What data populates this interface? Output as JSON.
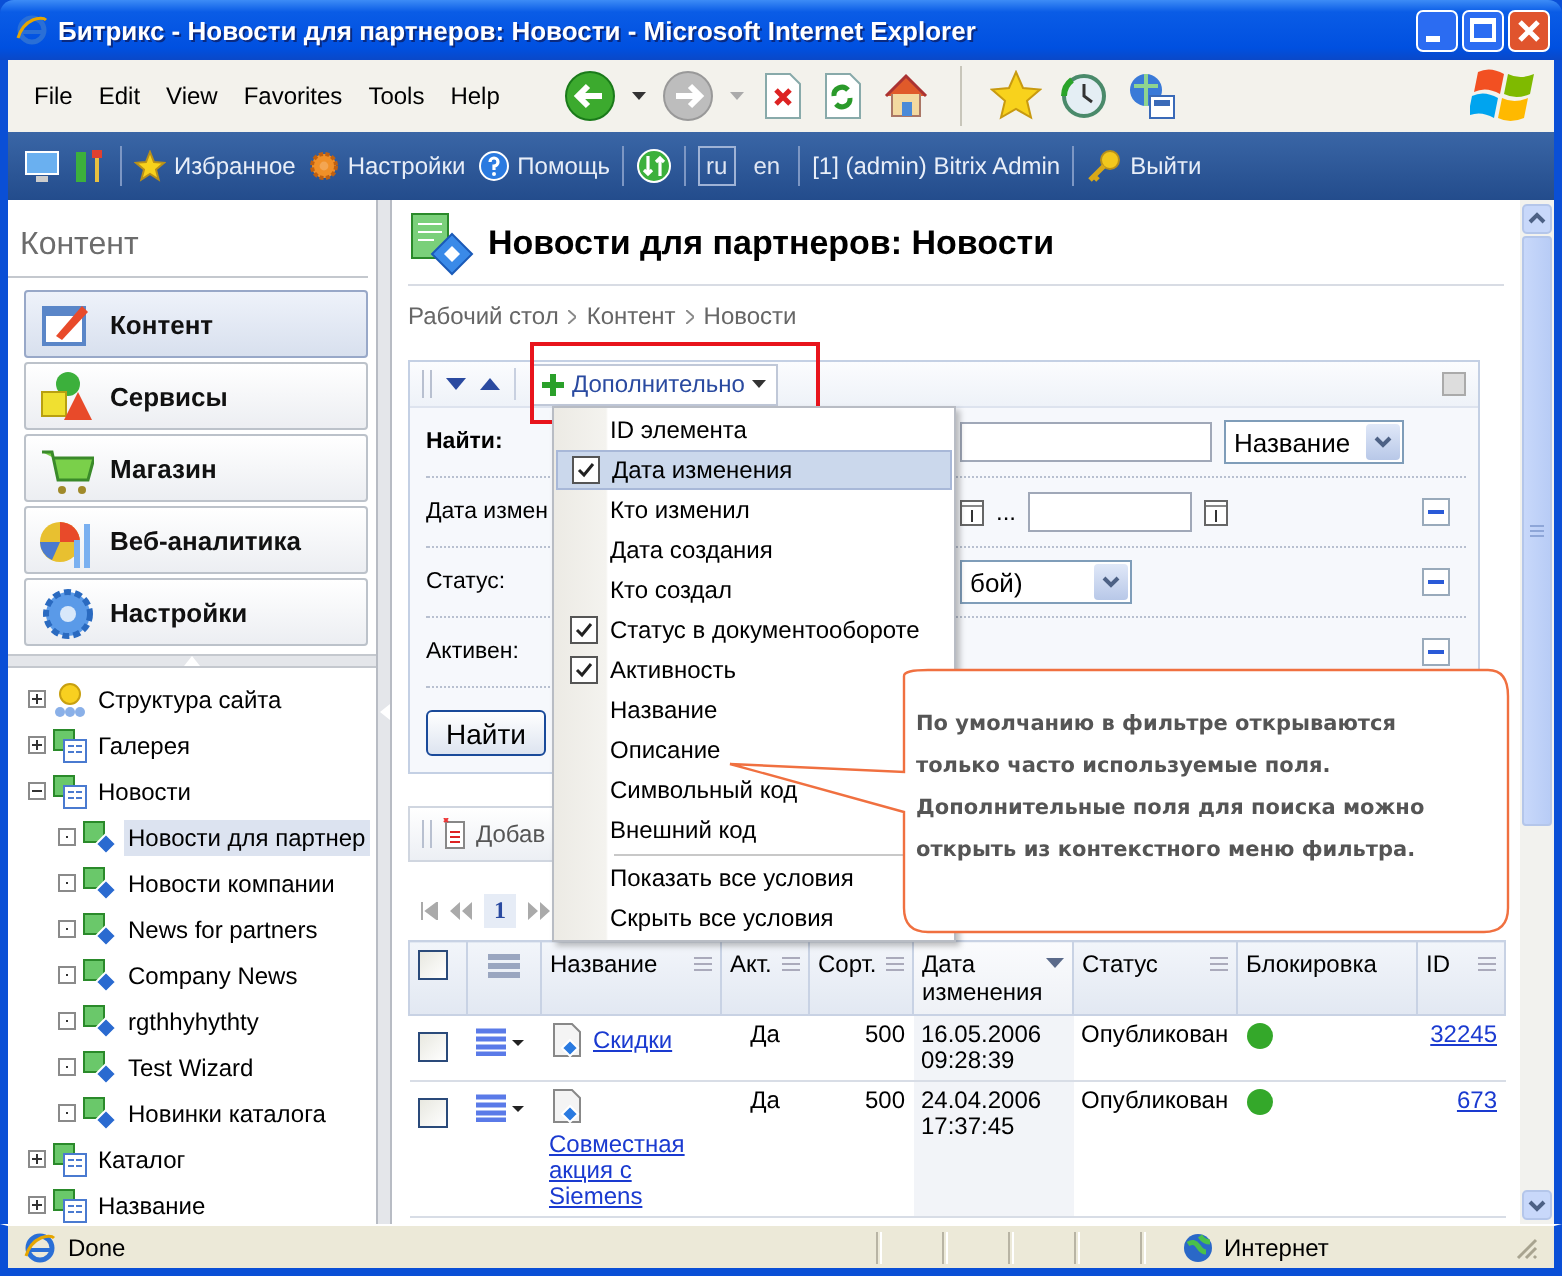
{
  "window": {
    "title": "Битрикс - Новости для партнеров: Новости - Microsoft Internet Explorer"
  },
  "menu_bar": [
    "File",
    "Edit",
    "View",
    "Favorites",
    "Tools",
    "Help"
  ],
  "admin_bar": {
    "links": [
      {
        "kind": "favorites",
        "label": "Избранное"
      },
      {
        "kind": "settings",
        "label": "Настройки"
      },
      {
        "kind": "help",
        "label": "Помощь"
      }
    ],
    "languages": [
      {
        "label": "ru",
        "selected": true
      },
      {
        "label": "en",
        "selected": false
      }
    ],
    "user": "[1] (admin) Bitrix Admin",
    "logout": "Выйти"
  },
  "sidebar": {
    "title": "Контент",
    "sections": [
      {
        "kind": "content",
        "label": "Контент",
        "selected": true
      },
      {
        "kind": "services",
        "label": "Сервисы",
        "selected": false
      },
      {
        "kind": "shop",
        "label": "Магазин",
        "selected": false
      },
      {
        "kind": "analytics",
        "label": "Веб-аналитика",
        "selected": false
      },
      {
        "kind": "settings",
        "label": "Настройки",
        "selected": false
      }
    ],
    "tree": [
      {
        "kind": "site",
        "label": "Структура сайта",
        "expanded": false,
        "selected": false
      },
      {
        "kind": "type",
        "label": "Галерея",
        "expanded": false,
        "selected": false
      },
      {
        "kind": "type",
        "label": "Новости",
        "expanded": true,
        "selected": false,
        "children": [
          {
            "kind": "block",
            "label": "Новости для партнер",
            "selected": true
          },
          {
            "kind": "block",
            "label": "Новости компании",
            "selected": false
          },
          {
            "kind": "block",
            "label": "News for partners",
            "selected": false
          },
          {
            "kind": "block",
            "label": "Company News",
            "selected": false
          },
          {
            "kind": "block",
            "label": "rgthhyhythty",
            "selected": false
          },
          {
            "kind": "block",
            "label": "Test Wizard",
            "selected": false
          },
          {
            "kind": "block",
            "label": "Новинки каталога",
            "selected": false
          }
        ]
      },
      {
        "kind": "type",
        "label": "Каталог",
        "expanded": false,
        "selected": false
      },
      {
        "kind": "type",
        "label": "Название",
        "expanded": false,
        "selected": false
      }
    ]
  },
  "page": {
    "title": "Новости для партнеров: Новости",
    "breadcrumbs": [
      "Рабочий стол",
      "Контент",
      "Новости"
    ]
  },
  "filter": {
    "menu_button": "Дополнительно",
    "rows": [
      {
        "kind": "search",
        "label": "Найти:",
        "select": "Название"
      },
      {
        "kind": "date_range",
        "label": "Дата измен",
        "separator": "..."
      },
      {
        "kind": "select",
        "label": "Статус:",
        "value": "бой)"
      },
      {
        "kind": "covered",
        "label": "Активен:"
      }
    ],
    "submit": "Найти",
    "menu": [
      {
        "kind": "field",
        "label": "ID элемента",
        "checked": false,
        "selected": false
      },
      {
        "kind": "field",
        "label": "Дата изменения",
        "checked": true,
        "selected": true
      },
      {
        "kind": "field",
        "label": "Кто изменил",
        "checked": false,
        "selected": false
      },
      {
        "kind": "field",
        "label": "Дата создания",
        "checked": false,
        "selected": false
      },
      {
        "kind": "field",
        "label": "Кто создал",
        "checked": false,
        "selected": false
      },
      {
        "kind": "field",
        "label": "Статус в документообороте",
        "checked": true,
        "selected": false
      },
      {
        "kind": "field",
        "label": "Активность",
        "checked": true,
        "selected": false
      },
      {
        "kind": "field",
        "label": "Название",
        "checked": false,
        "selected": false
      },
      {
        "kind": "field",
        "label": "Описание",
        "checked": false,
        "selected": false
      },
      {
        "kind": "field",
        "label": "Символьный код",
        "checked": false,
        "selected": false
      },
      {
        "kind": "field",
        "label": "Внешний код",
        "checked": false,
        "selected": false
      },
      {
        "kind": "action",
        "label": "Показать все условия"
      },
      {
        "kind": "action",
        "label": "Скрыть все условия"
      }
    ]
  },
  "callout": {
    "text": "По умолчанию в фильтре открываются только часто используемые поля. Дополнительные поля для поиска можно открыть из контекстного меню фильтра."
  },
  "toolbar": {
    "add_button": "Добав"
  },
  "pager": {
    "pages": [
      {
        "label": "1",
        "selected": true
      }
    ]
  },
  "table": {
    "select_all": {
      "checked": false
    },
    "columns": [
      {
        "kind": "checkbox"
      },
      {
        "kind": "actions"
      },
      {
        "kind": "text",
        "label": "Название",
        "sorted": false,
        "menu": true
      },
      {
        "kind": "text",
        "label": "Акт.",
        "sorted": false,
        "menu": true
      },
      {
        "kind": "text",
        "label": "Сорт.",
        "sorted": false,
        "menu": true
      },
      {
        "kind": "text",
        "label": "Дата изменения",
        "sorted": true,
        "menu": false
      },
      {
        "kind": "text",
        "label": "Статус",
        "sorted": false,
        "menu": true
      },
      {
        "kind": "text",
        "label": "Блокировка",
        "sorted": false,
        "menu": false
      },
      {
        "kind": "text",
        "label": "ID",
        "sorted": false,
        "menu": true
      }
    ],
    "rows": [
      {
        "checked": false,
        "name": "Скидки",
        "active": "Да",
        "sort": "500",
        "date": "16.05.2006 09:28:39",
        "status": "Опубликован",
        "color": "#34a82a",
        "id": "32245"
      },
      {
        "checked": false,
        "name": "Совместная акция с Siemens",
        "active": "Да",
        "sort": "500",
        "date": "24.04.2006 17:37:45",
        "status": "Опубликован",
        "color": "#34a82a",
        "id": "673"
      }
    ]
  },
  "status_bar": {
    "text": "Done",
    "zone": "Интернет"
  }
}
